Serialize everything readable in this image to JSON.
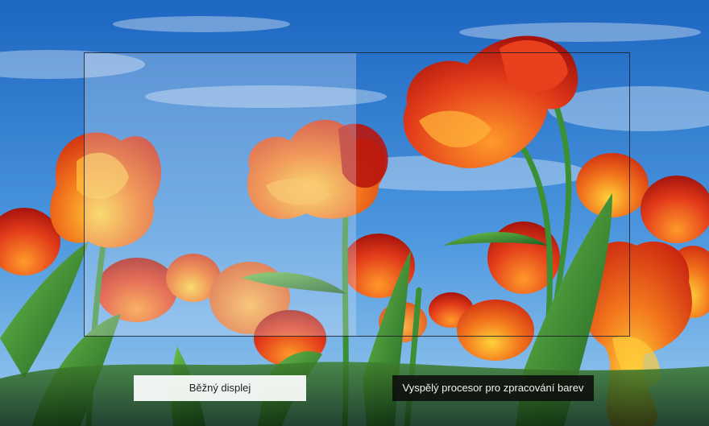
{
  "comparison": {
    "left_label": "Běžný displej",
    "right_label": "Vyspělý procesor pro zpracování barev"
  },
  "colors": {
    "sky_top": "#1f6fc9",
    "sky_bottom": "#8ec3ee",
    "petal_red": "#e1331c",
    "petal_orange": "#f47a1f",
    "petal_yellow": "#ffc233",
    "leaf_green": "#2f8a35"
  }
}
